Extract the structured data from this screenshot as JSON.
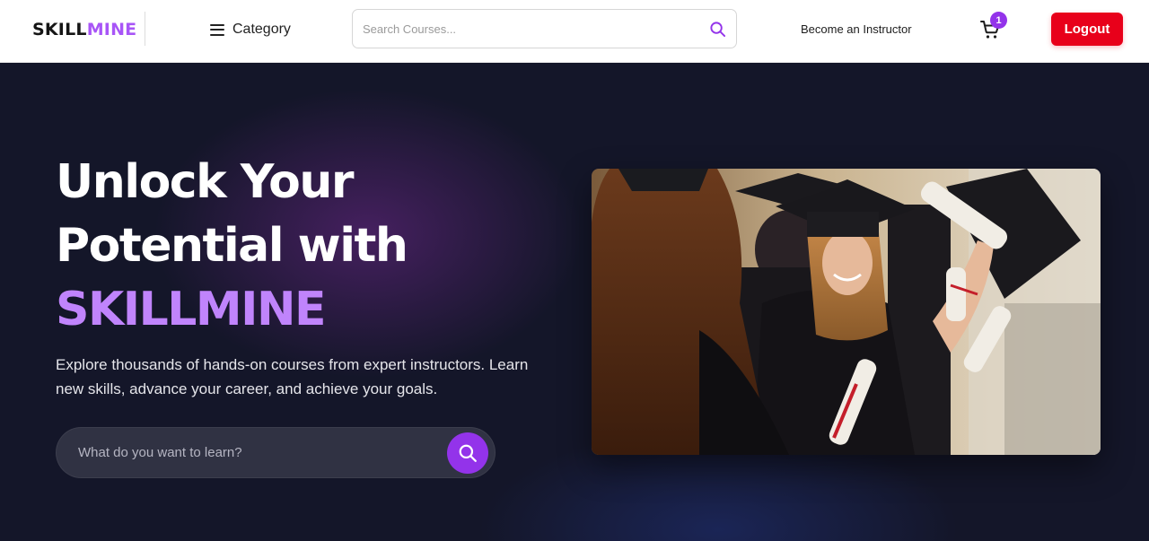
{
  "header": {
    "logo": {
      "part1": "SKILL",
      "part2": "MINE"
    },
    "category_label": "Category",
    "search": {
      "placeholder": "Search Courses..."
    },
    "instructor_link": "Become an Instructor",
    "cart_count": "1",
    "logout_label": "Logout",
    "icons": {
      "menu": "hamburger-icon",
      "search": "search-icon",
      "cart": "cart-icon"
    }
  },
  "hero": {
    "headline_line1": "Unlock Your",
    "headline_line2": "Potential with",
    "headline_accent": "SKILLMINE",
    "subtitle": "Explore thousands of hands-on courses from expert instructors. Learn new skills, advance your career, and achieve your goals.",
    "search": {
      "placeholder": "What do you want to learn?"
    },
    "image_subject": "graduates in caps and gowns holding diplomas"
  },
  "colors": {
    "brand_purple": "#a855f7",
    "accent_purple": "#9333ea",
    "logout_red": "#e8001a",
    "hero_bg": "#141629"
  }
}
